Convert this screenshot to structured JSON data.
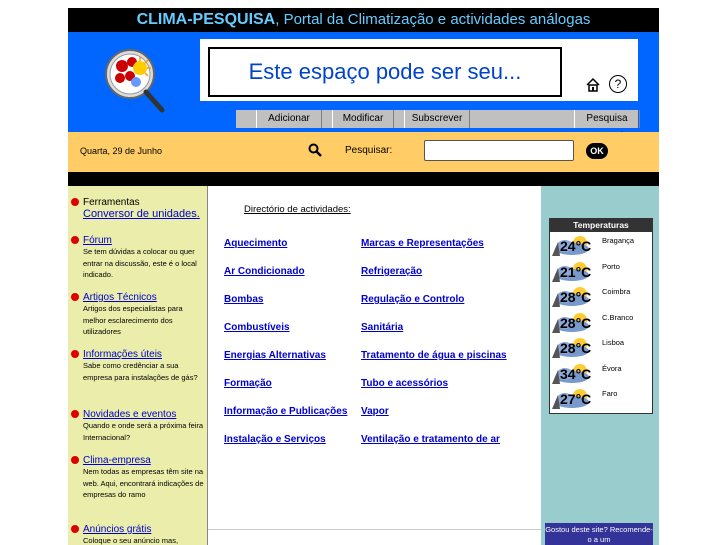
{
  "header": {
    "title": "CLIMA-PESQUISA",
    "subtitle": ", Portal da Climatização e actividades análogas"
  },
  "banner": {
    "ad_text": "Este espaço pode ser seu...",
    "icons": [
      "home-icon",
      "help-icon"
    ]
  },
  "nav": {
    "items": [
      "Adicionar",
      "Modificar",
      "Subscrever",
      "Pesquisa avançada"
    ]
  },
  "search": {
    "date": "Quarta, 29 de Junho",
    "label": "Pesquisar:",
    "value": "",
    "button": "OK"
  },
  "sidebar": {
    "tools_title": "Ferramentas",
    "tools_link": "Conversor de unidades.",
    "items": [
      {
        "title": "Fórum",
        "desc": "Se tem dúvidas a colocar ou quer entrar na discussão, este é o local indicado."
      },
      {
        "title": "Artigos Técnicos",
        "desc": "Artigos dos especialistas para melhor esclarecimento dos utilizadores"
      },
      {
        "title": "Informações úteis",
        "desc": "Sabe como credênciar a sua empresa para instalações de gás?"
      },
      {
        "title": "Novidades e eventos",
        "desc": "Quando e onde será a próxima feira Internacional?"
      },
      {
        "title": "Clima-empresa",
        "desc": "Nem todas as empresas têm site na web. Aqui, encontrará indicações de empresas do ramo"
      },
      {
        "title": "Anúncios grátis",
        "desc": "Coloque o seu anúncio mas,"
      }
    ]
  },
  "directory": {
    "title": "Directório de actividades:",
    "left": [
      "Aquecimento",
      "Ar Condicionado",
      "Bombas",
      "Combustíveis",
      "Energias Alternativas",
      "Formação",
      "Informação e Publicações",
      "Instalação e Serviços"
    ],
    "right": [
      "Marcas e Representações",
      "Refrigeração",
      "Regulação e Controlo",
      "Sanitária",
      "Tratamento de água e piscinas",
      "Tubo e acessórios",
      "Vapor",
      "Ventilação e tratamento de ar"
    ]
  },
  "temperatures": {
    "title": "Temperaturas",
    "rows": [
      {
        "temp": "24°C",
        "city": "Bragança"
      },
      {
        "temp": "21°C",
        "city": "Porto"
      },
      {
        "temp": "28°C",
        "city": "Coimbra"
      },
      {
        "temp": "28°C",
        "city": "C.Branco"
      },
      {
        "temp": "28°C",
        "city": "Lisboa"
      },
      {
        "temp": "34°C",
        "city": "Évora"
      },
      {
        "temp": "27°C",
        "city": "Faro"
      }
    ]
  },
  "promo": {
    "text": "Gostou deste site? Recomende-o a um"
  }
}
